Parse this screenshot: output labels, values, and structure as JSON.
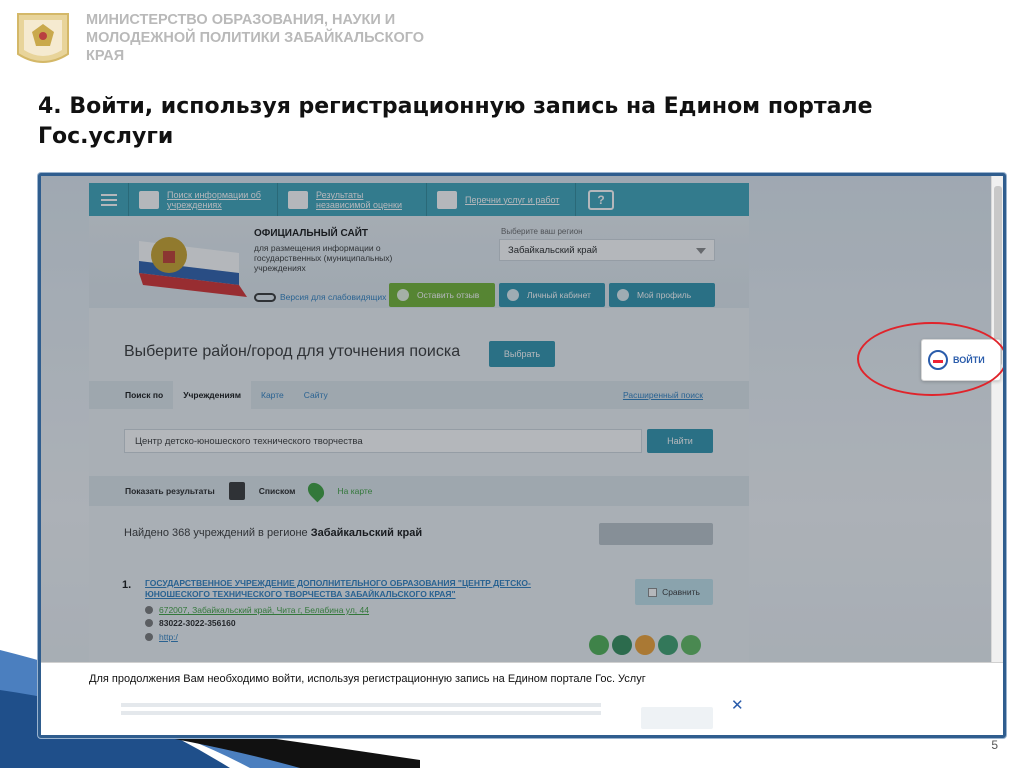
{
  "slide": {
    "ministry": "МИНИСТЕРСТВО ОБРАЗОВАНИЯ, НАУКИ И МОЛОДЕЖНОЙ ПОЛИТИКИ ЗАБАЙКАЛЬСКОГО КРАЯ",
    "title": "4. Войти, используя  регистрационную запись на Едином портале Гос.услуги",
    "page_number": "5"
  },
  "site": {
    "nav": [
      {
        "label": "Поиск информации об учреждениях",
        "icon": "building-icon"
      },
      {
        "label": "Результаты независимой оценки",
        "icon": "checklist-icon"
      },
      {
        "label": "Перечни услуг и работ",
        "icon": "briefcase-icon"
      }
    ],
    "official_title": "ОФИЦИАЛЬНЫЙ САЙТ",
    "official_sub": "для размещения информации о государственных (муниципальных) учреждениях",
    "weak_vision": "Версия для слабовидящих",
    "region_label": "Выберите ваш регион",
    "region_value": "Забайкальский край",
    "btn_feedback": "Оставить отзыв",
    "btn_cabinet": "Личный кабинет",
    "btn_profile": "Мой профиль",
    "choose_text": "Выберите район/город для уточнения поиска",
    "choose_btn": "Выбрать",
    "tabs": {
      "label": "Поиск по",
      "items": [
        "Учреждениям",
        "Карте",
        "Сайту"
      ],
      "advanced": "Расширенный поиск"
    },
    "search_value": "Центр детско-юношеского технического творчества",
    "find_btn": "Найти",
    "results": {
      "show_label": "Показать результаты",
      "list_label": "Списком",
      "map_label": "На карте"
    },
    "found_prefix": "Найдено 368 учреждений  в регионе",
    "found_region": "Забайкальский край",
    "item": {
      "number": "1.",
      "title": "ГОСУДАРСТВЕННОЕ УЧРЕЖДЕНИЕ ДОПОЛНИТЕЛЬНОГО ОБРАЗОВАНИЯ \"ЦЕНТР ДЕТСКО-ЮНОШЕСКОГО ТЕХНИЧЕСКОГО ТВОРЧЕСТВА ЗАБАЙКАЛЬСКОГО КРАЯ\"",
      "address": "672007, Забайкальский край, Чита г, Белабина ул, 44",
      "phone": "83022-3022-356160",
      "www": "http:/",
      "compare": "Сравнить",
      "badge_colors": [
        "#4caf50",
        "#2e8b57",
        "#f0a030",
        "#3a9e6a",
        "#5cb85c"
      ]
    }
  },
  "login": {
    "label": "ВОЙТИ",
    "logo": "gosuslugi-logo"
  },
  "notification": {
    "text": "Для продолжения Вам необходимо войти, используя регистрационную запись на Едином портале Гос. Услуг",
    "close": "✕"
  }
}
